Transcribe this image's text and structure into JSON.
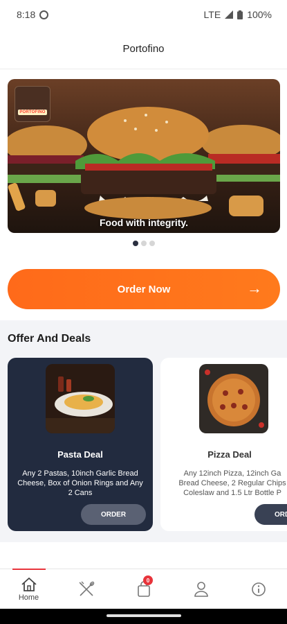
{
  "status_bar": {
    "time": "8:18",
    "network": "LTE",
    "battery": "100%"
  },
  "header": {
    "title": "Portofino"
  },
  "banner": {
    "logo_text": "PORTOFINO",
    "caption": "Food with integrity.",
    "slide_count": 3,
    "active_slide": 1
  },
  "order_button": {
    "label": "Order Now"
  },
  "offers": {
    "title": "Offer And Deals",
    "deals": [
      {
        "name": "Pasta Deal",
        "description": "Any 2 Pastas, 10inch Garlic Bread Cheese, Box of Onion Rings and Any 2 Cans",
        "button": "ORDER"
      },
      {
        "name": "Pizza Deal",
        "description_lines": [
          "Any 12inch Pizza, 12inch Ga",
          "Bread Cheese, 2 Regular Chips",
          "Coleslaw and 1.5 Ltr Bottle P"
        ],
        "button": "ORDER"
      }
    ]
  },
  "bottom_nav": {
    "home_label": "Home",
    "cart_count": "0"
  },
  "colors": {
    "accent": "#ff6a1a",
    "card_dark": "#222b3f",
    "nav_active": "#e8343b"
  }
}
